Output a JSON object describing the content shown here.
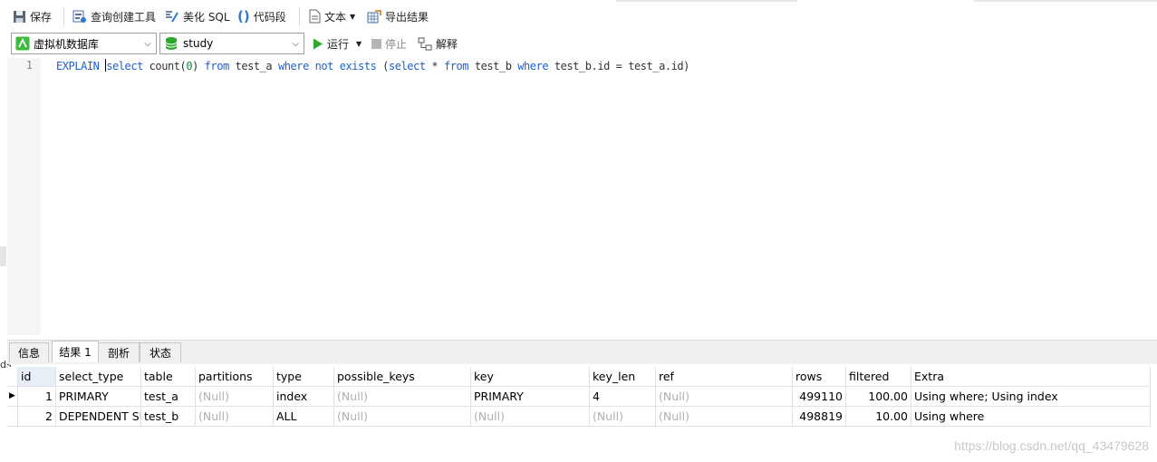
{
  "toolbar": {
    "save": "保存",
    "query_builder": "查询创建工具",
    "beautify": "美化 SQL",
    "snippet": "代码段",
    "text": "文本",
    "export": "导出结果"
  },
  "toolbar2": {
    "connection": "虚拟机数据库",
    "database": "study",
    "run": "运行",
    "stop": "停止",
    "explain": "解释"
  },
  "editor": {
    "line_number": "1",
    "sql": "EXPLAIN select count(0) from test_a where not exists (select * from test_b where test_b.id = test_a.id)"
  },
  "result_tabs": [
    "信息",
    "结果 1",
    "剖析",
    "状态"
  ],
  "grid": {
    "columns": [
      "id",
      "select_type",
      "table",
      "partitions",
      "type",
      "possible_keys",
      "key",
      "key_len",
      "ref",
      "rows",
      "filtered",
      "Extra"
    ],
    "rows": [
      [
        "1",
        "PRIMARY",
        "test_a",
        "(Null)",
        "index",
        "(Null)",
        "PRIMARY",
        "4",
        "(Null)",
        "499110",
        "100.00",
        "Using where; Using index"
      ],
      [
        "2",
        "DEPENDENT SUBQUERY",
        "test_b",
        "(Null)",
        "ALL",
        "(Null)",
        "(Null)",
        "(Null)",
        "(Null)",
        "498819",
        "10.00",
        "Using where"
      ]
    ]
  },
  "side_fragment": "ds",
  "watermark": "https://blog.csdn.net/qq_43479628",
  "colors": {
    "keyword": "#1b5fd1",
    "number": "#0b8a3c",
    "null": "#b0b0b0",
    "run_green": "#2ea82e"
  }
}
